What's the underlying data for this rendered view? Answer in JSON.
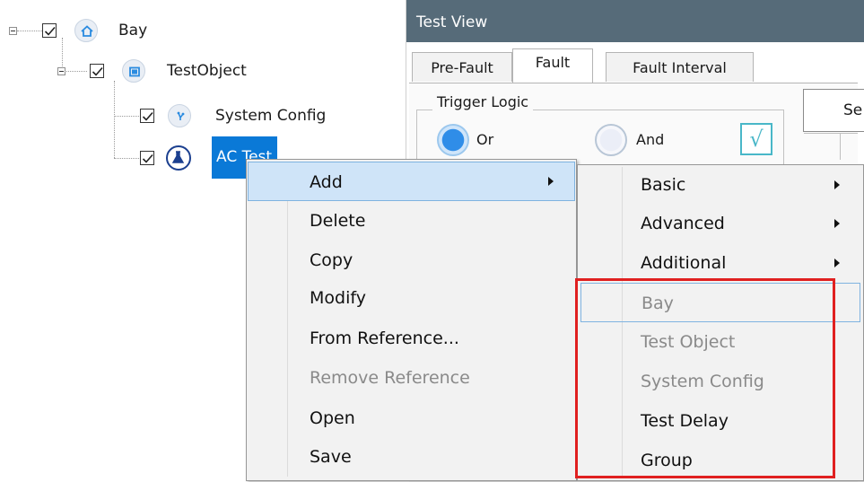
{
  "tree": {
    "nodes": [
      {
        "label": "Bay"
      },
      {
        "label": "TestObject"
      },
      {
        "label": "System Config"
      },
      {
        "label": "AC Test"
      }
    ]
  },
  "test_view": {
    "title": "Test View",
    "tabs": [
      {
        "label": "Pre-Fault"
      },
      {
        "label": "Fault"
      },
      {
        "label": "Fault Interval"
      }
    ],
    "trigger_logic": {
      "title": "Trigger Logic",
      "options": [
        {
          "label": "Or",
          "selected": true
        },
        {
          "label": "And",
          "selected": false
        }
      ]
    },
    "side_button_label": "Se"
  },
  "context_menu": {
    "items": [
      {
        "label": "Add",
        "has_submenu": true
      },
      {
        "label": "Delete"
      },
      {
        "label": "Copy"
      },
      {
        "label": "Modify"
      },
      {
        "label": "From Reference..."
      },
      {
        "label": "Remove Reference",
        "disabled": true
      },
      {
        "label": "Open"
      },
      {
        "label": "Save"
      }
    ]
  },
  "submenu": {
    "items": [
      {
        "label": "Basic",
        "has_submenu": true
      },
      {
        "label": "Advanced",
        "has_submenu": true
      },
      {
        "label": "Additional",
        "has_submenu": true
      },
      {
        "label": "Bay",
        "disabled": true
      },
      {
        "label": "Test Object",
        "disabled": true
      },
      {
        "label": "System Config",
        "disabled": true
      },
      {
        "label": "Test Delay"
      },
      {
        "label": "Group"
      }
    ]
  },
  "colors": {
    "selection": "#0a79d7",
    "header": "#566b79",
    "menu_highlight": "#cfe4f8",
    "annotation": "#e02020"
  }
}
